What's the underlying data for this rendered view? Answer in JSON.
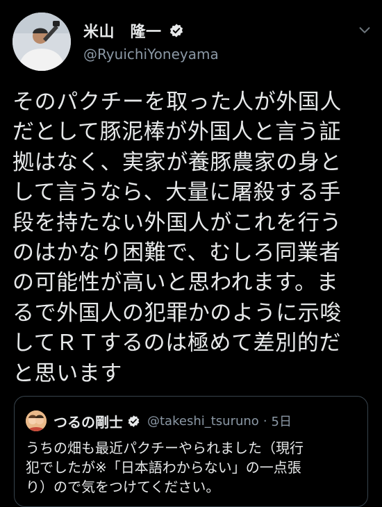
{
  "tweet": {
    "display_name": "米山　隆一",
    "handle": "@RyuichiYoneyama",
    "avatar_icon": "user-photo-avatar",
    "verified_icon": "verified-badge-icon",
    "menu_icon": "chevron-down-icon",
    "lines": [
      "そのパクチーを取った人が外国人",
      "だとして豚泥棒が外国人と言う証",
      "拠はなく、実家が養豚農家の身と",
      "して言うなら、大量に屠殺する手",
      "段を持たない外国人がこれを行う",
      "のはかなり困難で、むしろ同業者",
      "の可能性が高いと思われます。ま",
      "るで外国人の犯罪かのように示唆",
      "してＲＴするのは極めて差別的だ",
      "と思います"
    ]
  },
  "quoted_tweet": {
    "display_name": "つるの剛士",
    "handle": "@takeshi_tsuruno",
    "separator": "·",
    "time": "5日",
    "lines": [
      "うちの畑も最近パクチーやられました（現行",
      "犯でしたが※「日本語わからない」の一点張",
      "り）ので気をつけてください。"
    ]
  },
  "colors": {
    "background": "#000000",
    "text": "#e7e9ea",
    "secondary_text": "#8b98a5",
    "border": "#38444d"
  }
}
